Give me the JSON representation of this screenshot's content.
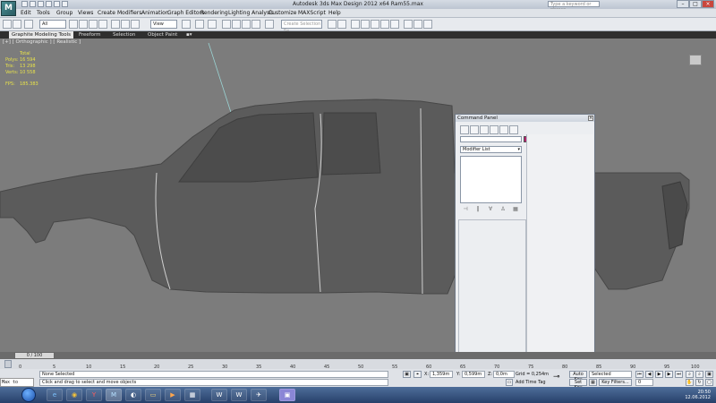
{
  "window": {
    "title": "Autodesk 3ds Max Design 2012 x64   Ram55.max",
    "search_placeholder": "Type a keyword or phrase",
    "logo": "M"
  },
  "menu": [
    "Edit",
    "Tools",
    "Group",
    "Views",
    "Create",
    "Modifiers",
    "Animation",
    "Graph Editors",
    "Rendering",
    "Lighting Analysis",
    "Customize",
    "MAXScript",
    "Help"
  ],
  "toolbar": {
    "selection_filter": "All",
    "ref_coord": "View",
    "named_selection": "Create Selection Se"
  },
  "ribbon": {
    "tabs": [
      "Graphite Modeling Tools",
      "Freeform",
      "Selection",
      "Object Paint"
    ]
  },
  "viewport": {
    "label": "[+] [ Orthographic ] [ Realistic ]",
    "stats": {
      "header": "Total",
      "polys_label": "Polys:",
      "polys": "16 594",
      "tris_label": "Tris:",
      "tris": "13 298",
      "verts_label": "Verts:",
      "verts": "10 558",
      "fps_label": "FPS:",
      "fps": "185.383"
    }
  },
  "command_panel": {
    "title": "Command Panel",
    "modifier_list": "Modifier List"
  },
  "timeline": {
    "slider": "0 / 100",
    "ticks": [
      "0",
      "5",
      "10",
      "15",
      "20",
      "25",
      "30",
      "35",
      "40",
      "45",
      "50",
      "55",
      "60",
      "65",
      "70",
      "75",
      "80",
      "85",
      "90",
      "95",
      "100"
    ]
  },
  "status": {
    "selection": "None Selected",
    "prompt": "Click and drag to select and move objects",
    "x_label": "X:",
    "x_value": "1,359m",
    "y_label": "Y:",
    "y_value": "0,599m",
    "z_label": "Z:",
    "z_value": "0,0m",
    "grid": "Grid = 0,254m",
    "add_time_tag": "Add Time Tag",
    "auto_key": "Auto Key",
    "set_key": "Set Key",
    "key_mode": "Selected",
    "key_filters": "Key Filters...",
    "frame": "0"
  },
  "maxscript": {
    "label": "Max to Physc"
  },
  "taskbar": {
    "apps": [
      "e",
      "◉",
      "Y",
      "▤",
      "M",
      "◐",
      "▭",
      "▶",
      "▦",
      "W",
      "W",
      "✈",
      "▣"
    ],
    "time": "20:50",
    "date": "12.06.2012"
  },
  "colors": {
    "object_color": "#b3236d",
    "viewport_bg": "#7c7c7c",
    "stats_text": "#e8e24a"
  }
}
